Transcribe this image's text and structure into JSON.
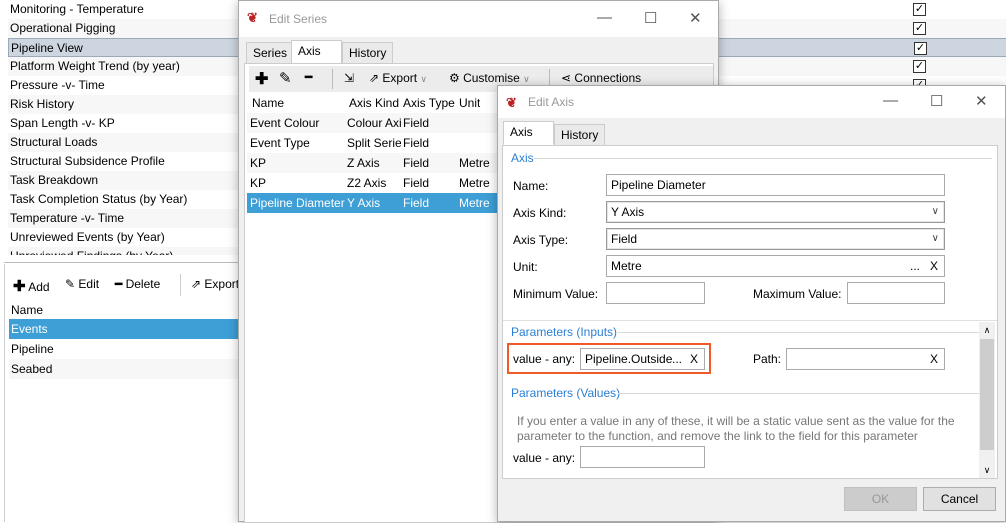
{
  "background_list": {
    "items": [
      {
        "label": "Monitoring - Temperature",
        "checked": true
      },
      {
        "label": "Operational Pigging",
        "checked": true
      },
      {
        "label": "Pipeline View",
        "checked": true,
        "selected": true
      },
      {
        "label": "Platform Weight Trend (by year)",
        "checked": true
      },
      {
        "label": "Pressure -v- Time",
        "checked": true
      },
      {
        "label": "Risk History"
      },
      {
        "label": "Span Length -v- KP"
      },
      {
        "label": "Structural Loads"
      },
      {
        "label": "Structural Subsidence Profile"
      },
      {
        "label": "Task Breakdown"
      },
      {
        "label": "Task Completion Status (by Year)"
      },
      {
        "label": "Temperature -v- Time"
      },
      {
        "label": "Unreviewed Events (by Year)"
      },
      {
        "label": "Unreviewed Findings (by Year)"
      }
    ],
    "check_mark": "✓"
  },
  "lower_panel": {
    "toolbar": {
      "add": "Add",
      "edit": "Edit",
      "delete": "Delete",
      "export": "Export"
    },
    "header": "Name",
    "rows": [
      "Events",
      "Pipeline",
      "Seabed"
    ],
    "selected": "Events"
  },
  "edit_series": {
    "title": "Edit Series",
    "tabs": [
      "Series",
      "Axis",
      "History"
    ],
    "active_tab": "Axis",
    "toolbar": {
      "export": "Export",
      "customise": "Customise",
      "connections": "Connections"
    },
    "columns": [
      "Name",
      "Axis Kind",
      "Axis Type",
      "Unit",
      "M"
    ],
    "rows": [
      {
        "name": "Event Colour",
        "kind": "Colour Axis",
        "type": "Field",
        "unit": ""
      },
      {
        "name": "Event Type",
        "kind": "Split Series",
        "type": "Field",
        "unit": ""
      },
      {
        "name": "KP",
        "kind": "Z Axis",
        "type": "Field",
        "unit": "Metre"
      },
      {
        "name": "KP",
        "kind": "Z2 Axis",
        "type": "Field",
        "unit": "Metre"
      },
      {
        "name": "Pipeline Diameter",
        "kind": "Y Axis",
        "type": "Field",
        "unit": "Metre"
      }
    ],
    "selected_row": "Pipeline Diameter"
  },
  "edit_axis": {
    "title": "Edit Axis",
    "tabs": [
      "Axis",
      "History"
    ],
    "active_tab": "Axis",
    "section_axis": "Axis",
    "name_label": "Name:",
    "name_value": "Pipeline Diameter",
    "kind_label": "Axis Kind:",
    "kind_value": "Y Axis",
    "type_label": "Axis Type:",
    "type_value": "Field",
    "unit_label": "Unit:",
    "unit_value": "Metre",
    "min_label": "Minimum Value:",
    "min_value": "",
    "max_label": "Maximum Value:",
    "max_value": "",
    "section_inputs": "Parameters (Inputs)",
    "input_value_label": "value - any:",
    "input_value": "Pipeline.Outside",
    "path_label": "Path:",
    "path_value": "",
    "section_values": "Parameters (Values)",
    "values_help": "If you enter a value in any of these, it will be a static value sent as the value for the parameter to the function, and remove the link to the field for this parameter",
    "values_value_label": "value - any:",
    "values_value": "",
    "ellipsis": "...",
    "clear": "X",
    "ok": "OK",
    "cancel": "Cancel",
    "highlight_color": "#f05a28",
    "accent_color": "#2a7fd4"
  },
  "selection_color": "#3d9fd6"
}
